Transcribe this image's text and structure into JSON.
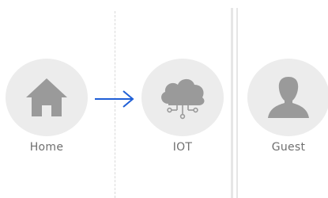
{
  "nodes": [
    {
      "label": "Home",
      "icon": "home-icon"
    },
    {
      "label": "IOT",
      "icon": "cloud-iot-icon"
    },
    {
      "label": "Guest",
      "icon": "user-silhouette-icon"
    }
  ],
  "colors": {
    "circle": "#ececec",
    "icon": "#9a9a9a",
    "arrow": "#1f5fd6",
    "label": "#6f6f6f",
    "divider": "#e0e0e0"
  }
}
